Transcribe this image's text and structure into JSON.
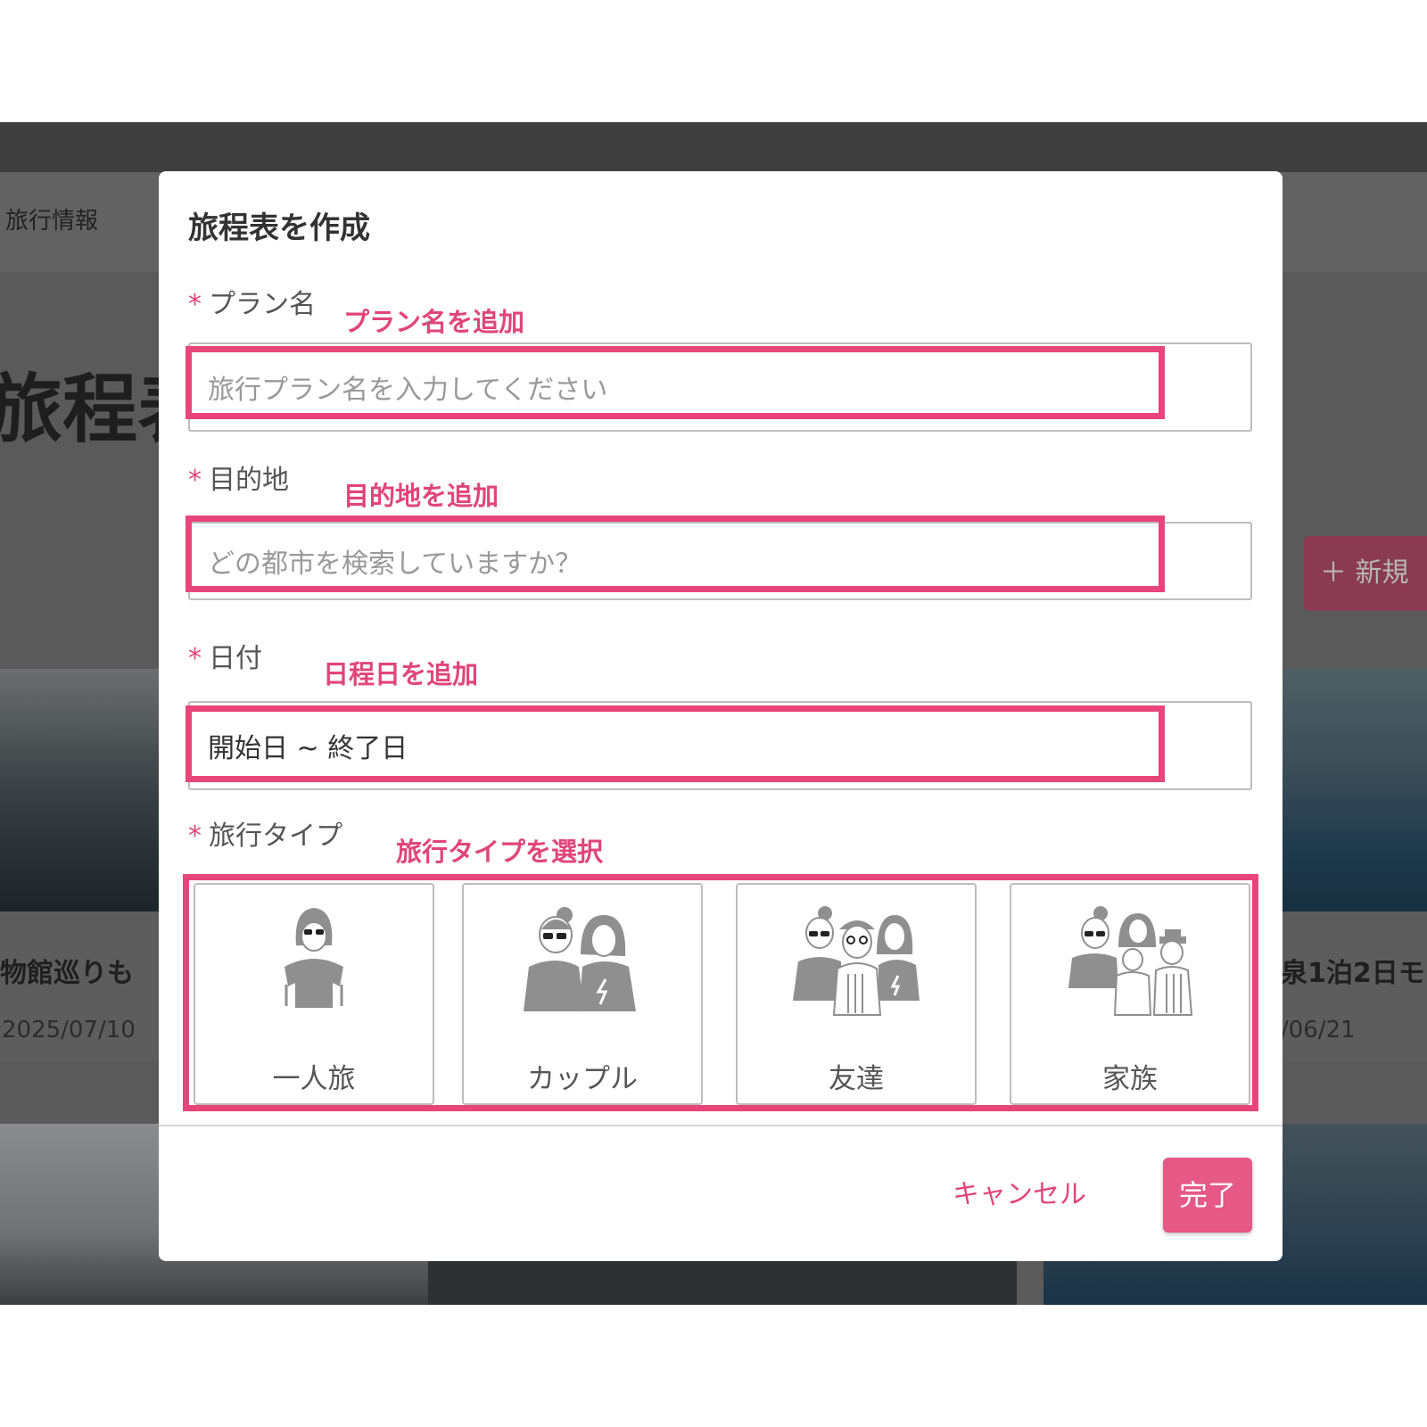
{
  "background": {
    "nav_item": "旅行情報",
    "page_heading": "旅程表",
    "new_button_label": "＋ 新規",
    "left_card": {
      "title": "物館巡りも",
      "date": "2025/07/10"
    },
    "right_card": {
      "title": "泉1泊2日モ",
      "date": "/06/21"
    }
  },
  "modal": {
    "title": "旅程表を作成",
    "fields": {
      "plan_name": {
        "required": "*",
        "label": "プラン名",
        "annotation": "プラン名を追加",
        "placeholder": "旅行プラン名を入力してください"
      },
      "destination": {
        "required": "*",
        "label": "目的地",
        "annotation": "目的地を追加",
        "placeholder": "どの都市を検索していますか？"
      },
      "date": {
        "required": "*",
        "label": "日付",
        "annotation": "日程日を追加",
        "value": "開始日 ~ 終了日"
      },
      "trip_type": {
        "required": "*",
        "label": "旅行タイプ",
        "annotation": "旅行タイプを選択",
        "options": [
          "一人旅",
          "カップル",
          "友達",
          "家族"
        ]
      }
    },
    "cancel_label": "キャンセル",
    "done_label": "完了"
  },
  "colors": {
    "accent": "#e0457a",
    "highlight": "#e8457a",
    "done_button": "#e65885",
    "overlay": "#5a5a5a"
  }
}
